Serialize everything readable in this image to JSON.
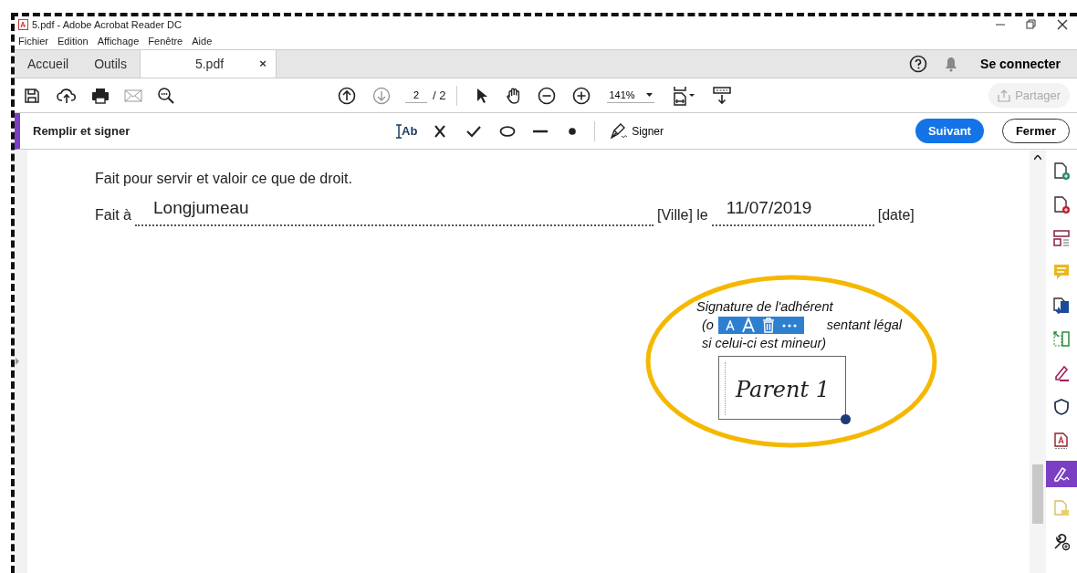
{
  "window": {
    "title": "5.pdf - Adobe Acrobat Reader DC"
  },
  "menu": [
    "Fichier",
    "Edition",
    "Affichage",
    "Fenêtre",
    "Aide"
  ],
  "tabs": [
    {
      "label": "Accueil",
      "selected": false
    },
    {
      "label": "Outils",
      "selected": false
    },
    {
      "label": "5.pdf",
      "selected": true,
      "close": "×"
    }
  ],
  "account": {
    "sign_in": "Se connecter"
  },
  "toolbar": {
    "page": "2",
    "page_total": "/ 2",
    "zoom": "141%",
    "share": "Partager",
    "share_disabled": true
  },
  "fill_sign": {
    "title": "Remplir et signer",
    "text_tool": "Ab",
    "sign": "Signer",
    "next": "Suivant",
    "close": "Fermer"
  },
  "document": {
    "line1": "Fait pour servir et valoir ce que de droit.",
    "place_label": "Fait à",
    "place_value": "Longjumeau",
    "place_hint": "[Ville] le",
    "date_value": "11/07/2019",
    "date_hint": "[date]",
    "caption_line1": "Signature de l'adhérent",
    "caption_line2_start": "(o",
    "caption_line2_end": "sentant légal",
    "caption_line3": "si celui-ci est mineur)",
    "signature": "Parent 1"
  },
  "tools": [
    {
      "kind": "create",
      "selected": false
    },
    {
      "kind": "combine",
      "selected": false
    },
    {
      "kind": "organize",
      "selected": false
    },
    {
      "kind": "comment",
      "selected": false
    },
    {
      "kind": "export",
      "selected": false
    },
    {
      "kind": "scan",
      "selected": false
    },
    {
      "kind": "edit",
      "selected": false
    },
    {
      "kind": "protect",
      "selected": false
    },
    {
      "kind": "pdf",
      "selected": false
    },
    {
      "kind": "sign",
      "selected": true
    },
    {
      "kind": "send",
      "selected": false
    },
    {
      "kind": "more",
      "selected": false
    }
  ]
}
